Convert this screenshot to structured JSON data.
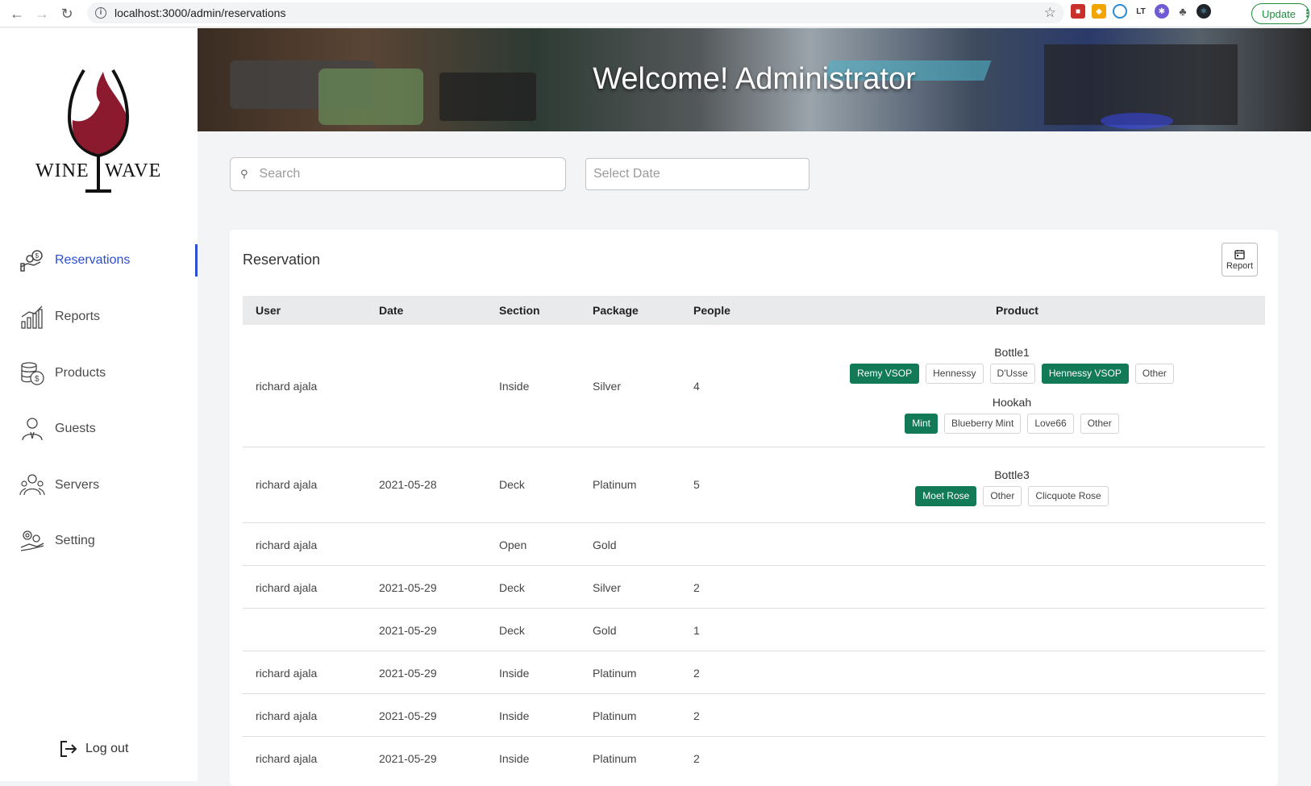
{
  "browser": {
    "url": "localhost:3000/admin/reservations",
    "update_label": "Update"
  },
  "sidebar": {
    "brand_left": "WINE",
    "brand_right": "WAVE",
    "items": [
      {
        "label": "Reservations",
        "icon": "money-hand-icon",
        "active": true
      },
      {
        "label": "Reports",
        "icon": "bar-chart-icon",
        "active": false
      },
      {
        "label": "Products",
        "icon": "coins-icon",
        "active": false
      },
      {
        "label": "Guests",
        "icon": "guest-person-icon",
        "active": false
      },
      {
        "label": "Servers",
        "icon": "servers-people-icon",
        "active": false
      },
      {
        "label": "Setting",
        "icon": "gear-hand-icon",
        "active": false
      }
    ],
    "logout_label": "Log out"
  },
  "banner": {
    "title": "Welcome! Administrator"
  },
  "filters": {
    "search_placeholder": "Search",
    "date_placeholder": "Select Date"
  },
  "card": {
    "title": "Reservation",
    "report_label": "Report",
    "columns": [
      "User",
      "Date",
      "Section",
      "Package",
      "People",
      "Product"
    ],
    "rows": [
      {
        "user": "richard ajala",
        "date": "",
        "section": "Inside",
        "package": "Silver",
        "people": "4",
        "products": [
          {
            "label": "Bottle1",
            "options": [
              {
                "name": "Remy VSOP",
                "selected": true
              },
              {
                "name": "Hennessy",
                "selected": false
              },
              {
                "name": "D'Usse",
                "selected": false
              },
              {
                "name": "Hennessy VSOP",
                "selected": true
              },
              {
                "name": "Other",
                "selected": false
              }
            ]
          },
          {
            "label": "Hookah",
            "options": [
              {
                "name": "Mint",
                "selected": true
              },
              {
                "name": "Blueberry Mint",
                "selected": false
              },
              {
                "name": "Love66",
                "selected": false
              },
              {
                "name": "Other",
                "selected": false
              }
            ]
          }
        ]
      },
      {
        "user": "richard ajala",
        "date": "2021-05-28",
        "section": "Deck",
        "package": "Platinum",
        "people": "5",
        "products": [
          {
            "label": "Bottle3",
            "options": [
              {
                "name": "Moet Rose",
                "selected": true
              },
              {
                "name": "Other",
                "selected": false
              },
              {
                "name": "Clicquote Rose",
                "selected": false
              }
            ]
          }
        ]
      },
      {
        "user": "richard ajala",
        "date": "",
        "section": "Open",
        "package": "Gold",
        "people": "",
        "products": []
      },
      {
        "user": "richard ajala",
        "date": "2021-05-29",
        "section": "Deck",
        "package": "Silver",
        "people": "2",
        "products": []
      },
      {
        "user": "",
        "date": "2021-05-29",
        "section": "Deck",
        "package": "Gold",
        "people": "1",
        "products": []
      },
      {
        "user": "richard ajala",
        "date": "2021-05-29",
        "section": "Inside",
        "package": "Platinum",
        "people": "2",
        "products": []
      },
      {
        "user": "richard ajala",
        "date": "2021-05-29",
        "section": "Inside",
        "package": "Platinum",
        "people": "2",
        "products": []
      },
      {
        "user": "richard ajala",
        "date": "2021-05-29",
        "section": "Inside",
        "package": "Platinum",
        "people": "2",
        "products": []
      }
    ]
  }
}
